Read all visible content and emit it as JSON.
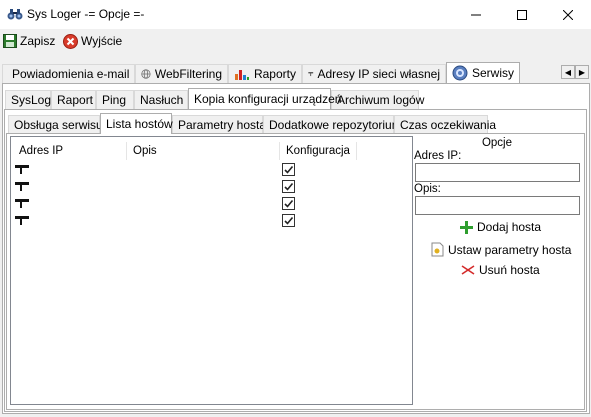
{
  "window": {
    "title": "Sys Loger -= Opcje =-"
  },
  "toolbar": {
    "save_label": "Zapisz",
    "exit_label": "Wyjście"
  },
  "main_tabs": [
    {
      "label": "Powiadomienia e-mail",
      "icon": "monitor-icon"
    },
    {
      "label": "WebFiltering",
      "icon": "globe-icon"
    },
    {
      "label": "Raporty",
      "icon": "chart-icon"
    },
    {
      "label": "Adresy IP sieci własnej",
      "icon": "network-icon"
    },
    {
      "label": "Serwisy",
      "icon": "services-icon",
      "active": true
    }
  ],
  "sub_tabs": [
    {
      "label": "SysLog"
    },
    {
      "label": "Raport"
    },
    {
      "label": "Ping"
    },
    {
      "label": "Nasłuch"
    },
    {
      "label": "Kopia konfiguracji urządzeń",
      "active": true
    },
    {
      "label": "Archiwum logów"
    }
  ],
  "inner_tabs": [
    {
      "label": "Obsługa serwisu"
    },
    {
      "label": "Lista hostów",
      "active": true
    },
    {
      "label": "Parametry hosta"
    },
    {
      "label": "Dodatkowe repozytorium"
    },
    {
      "label": "Czas oczekiwania"
    }
  ],
  "host_table": {
    "columns": [
      "Adres IP",
      "Opis",
      "Konfiguracja"
    ],
    "rows": [
      {
        "ip": "",
        "desc": "",
        "config": true
      },
      {
        "ip": "",
        "desc": "",
        "config": true
      },
      {
        "ip": "",
        "desc": "",
        "config": true
      },
      {
        "ip": "",
        "desc": "",
        "config": true
      }
    ]
  },
  "options": {
    "header": "Opcje",
    "ip_label": "Adres IP:",
    "ip_value": "",
    "desc_label": "Opis:",
    "desc_value": "",
    "add_host": "Dodaj hosta",
    "set_params": "Ustaw parametry hosta",
    "remove_host": "Usuń hosta"
  },
  "colors": {
    "add": "#2e9e2e",
    "remove": "#d42a2a",
    "exit": "#d83b2a",
    "save": "#2a7a2a"
  }
}
